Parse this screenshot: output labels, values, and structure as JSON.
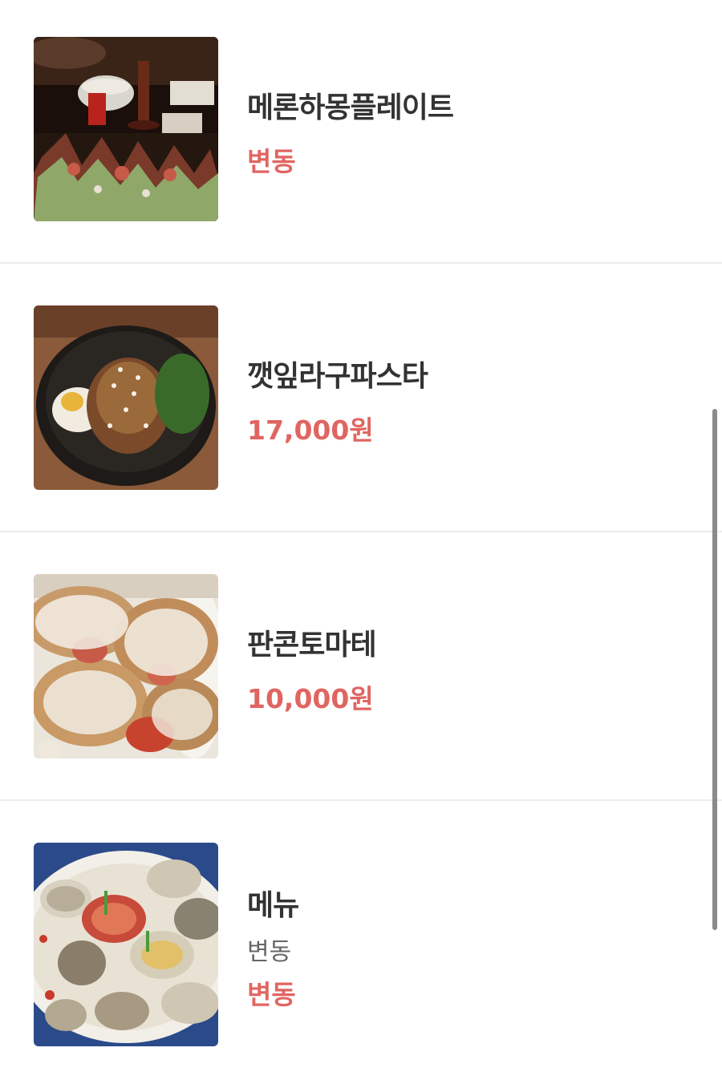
{
  "menu": {
    "items": [
      {
        "name": "메론하몽플레이트",
        "price": "변동",
        "image_icon": "melon-jamon-plate-photo"
      },
      {
        "name": "깻잎라구파스타",
        "price": "17,000원",
        "image_icon": "perilla-ragu-pasta-photo"
      },
      {
        "name": "판콘토마테",
        "price": "10,000원",
        "image_icon": "pan-con-tomate-photo"
      },
      {
        "name": "메뉴",
        "description": "변동",
        "price": "변동",
        "image_icon": "clam-seafood-photo"
      }
    ]
  },
  "colors": {
    "price": "#e06562",
    "name": "#333333",
    "description": "#666666",
    "divider": "#ececec",
    "scrollbar": "#8a8a8a"
  }
}
